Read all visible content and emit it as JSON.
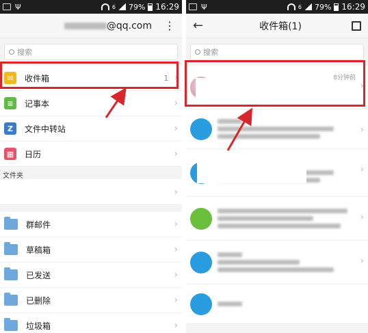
{
  "status_bar": {
    "battery": "79%",
    "time": "16:29",
    "signal_label": "6"
  },
  "left": {
    "account_suffix": "@qq.com",
    "search_placeholder": "搜索",
    "top_items": [
      {
        "label": "收件箱",
        "count": "1",
        "icon": "inbox-icon",
        "color": "#f2b81e"
      },
      {
        "label": "记事本",
        "icon": "notepad-icon",
        "color": "#5dbb46"
      },
      {
        "label": "文件中转站",
        "icon": "file-transfer-icon",
        "color": "#3b7cc9",
        "glyph": "Z"
      },
      {
        "label": "日历",
        "icon": "calendar-icon",
        "color": "#e5546a"
      }
    ],
    "section_label": "文件夹",
    "folders": [
      "群邮件",
      "草稿箱",
      "已发送",
      "已删除",
      "垃圾箱"
    ]
  },
  "right": {
    "title": "收件箱(1)",
    "search_placeholder": "搜索",
    "first_mail_time": "8分钟前"
  },
  "colors": {
    "highlight": "#d8262a",
    "folder": "#6fa8dc"
  }
}
